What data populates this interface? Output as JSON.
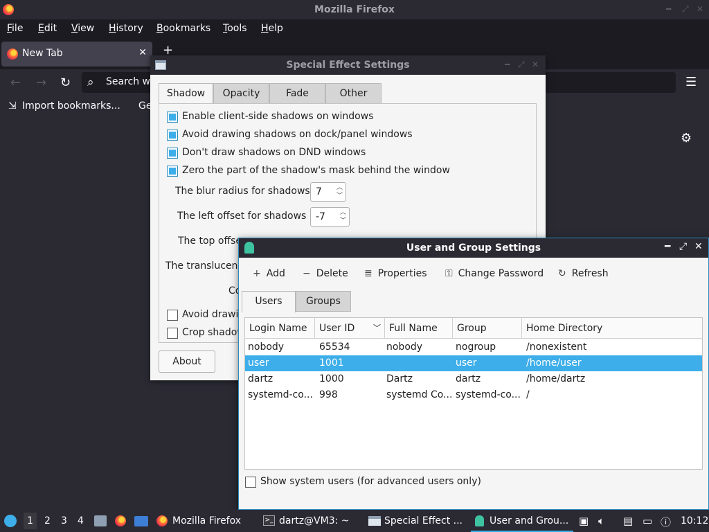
{
  "firefox": {
    "window_title": "Mozilla Firefox",
    "menu": [
      "File",
      "Edit",
      "View",
      "History",
      "Bookmarks",
      "Tools",
      "Help"
    ],
    "tab_label": "New Tab",
    "search_placeholder": "Search w",
    "bookmarks": [
      "Import bookmarks...",
      "Ge"
    ]
  },
  "special_effects": {
    "title": "Special Effect Settings",
    "tabs": [
      "Shadow",
      "Opacity",
      "Fade",
      "Other"
    ],
    "options": [
      {
        "label": "Enable client-side shadows on windows",
        "checked": true
      },
      {
        "label": "Avoid drawing shadows on dock/panel windows",
        "checked": true
      },
      {
        "label": "Don't draw shadows on DND windows",
        "checked": true
      },
      {
        "label": "Zero the part of the shadow's mask behind the window",
        "checked": true
      }
    ],
    "blur_label": "The blur radius for shadows",
    "blur_value": "7",
    "left_offset_label": "The left offset for shadows",
    "left_offset_value": "-7",
    "top_offset_label": "The top offse",
    "translucency_label": "The translucenc",
    "co_label": "Co",
    "lower_options": [
      {
        "label": "Avoid drawin",
        "checked": false
      },
      {
        "label": "Crop shadow",
        "checked": false
      }
    ],
    "about_label": "About"
  },
  "user_group": {
    "title": "User and Group Settings",
    "toolbar": {
      "add": "Add",
      "delete": "Delete",
      "properties": "Properties",
      "change_password": "Change Password",
      "refresh": "Refresh"
    },
    "tabs": [
      "Users",
      "Groups"
    ],
    "columns": [
      "Login Name",
      "User ID",
      "Full Name",
      "Group",
      "Home Directory"
    ],
    "rows": [
      {
        "login": "nobody",
        "uid": "65534",
        "full_name": "nobody",
        "group": "nogroup",
        "home": "/nonexistent",
        "selected": false
      },
      {
        "login": "user",
        "uid": "1001",
        "full_name": "",
        "group": "user",
        "home": "/home/user",
        "selected": true
      },
      {
        "login": "dartz",
        "uid": "1000",
        "full_name": "Dartz",
        "group": "dartz",
        "home": "/home/dartz",
        "selected": false
      },
      {
        "login": "systemd-co...",
        "uid": "998",
        "full_name": "systemd Co...",
        "group": "systemd-co...",
        "home": "/",
        "selected": false
      }
    ],
    "show_system_label": "Show system users (for advanced users only)",
    "show_system_checked": false
  },
  "taskbar": {
    "workspaces": [
      "1",
      "2",
      "3",
      "4"
    ],
    "active_workspace": "1",
    "tasks": [
      "Mozilla Firefox",
      "dartz@VM3: ~",
      "Special Effect ...",
      "User and Grou..."
    ],
    "active_task": "User and Grou...",
    "clock": "10:12"
  },
  "icons": {
    "accent": "#3daee9",
    "app_icon": "lxqt-leaf-icon"
  }
}
